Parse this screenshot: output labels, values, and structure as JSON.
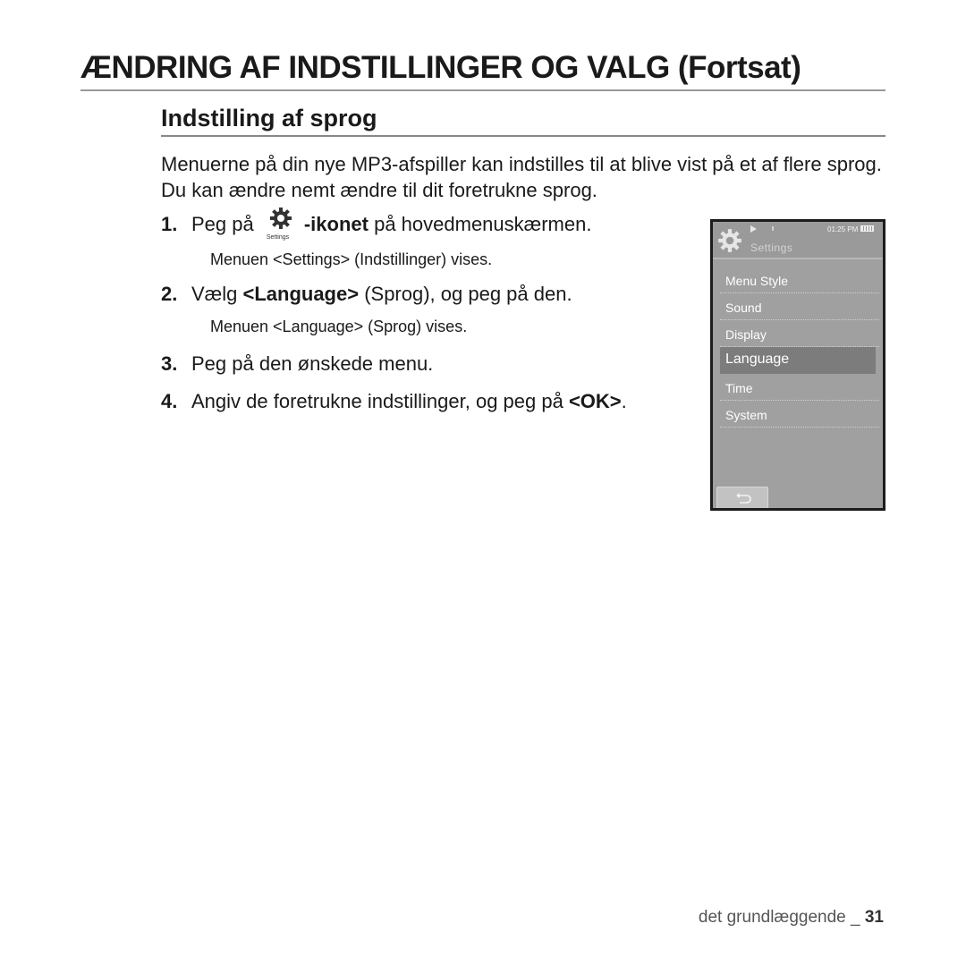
{
  "page": {
    "title": "ÆNDRING AF INDSTILLINGER OG VALG (Fortsat)",
    "section_title": "Indstilling af sprog",
    "intro": "Menuerne på din nye MP3-afspiller kan indstilles til at blive vist på et af flere sprog. Du kan ændre nemt ændre til dit foretrukne sprog.",
    "steps": [
      {
        "num": "1.",
        "pre": "Peg på",
        "icon": "settings-gear-icon",
        "icon_label": "Settings",
        "bold": "-ikonet",
        "post": " på hovedmenuskærmen.",
        "sub": "Menuen <Settings> (Indstillinger) vises."
      },
      {
        "num": "2.",
        "pre": "Vælg ",
        "bold": "<Language>",
        "post": " (Sprog), og peg på den.",
        "sub": "Menuen <Language> (Sprog) vises."
      },
      {
        "num": "3.",
        "text": "Peg på den ønskede menu."
      },
      {
        "num": "4.",
        "pre": "Angiv de foretrukne indstillinger, og peg på ",
        "bold": "<OK>",
        "post": "."
      }
    ]
  },
  "device": {
    "time": "01:25 PM",
    "title": "Settings",
    "menu": [
      {
        "label": "Menu Style",
        "selected": false
      },
      {
        "label": "Sound",
        "selected": false
      },
      {
        "label": "Display",
        "selected": false
      },
      {
        "label": "Language",
        "selected": true
      },
      {
        "label": "Time",
        "selected": false
      },
      {
        "label": "System",
        "selected": false
      }
    ],
    "back_icon": "back-arrow-icon"
  },
  "footer": {
    "section": "det grundlæggende _ ",
    "page_number": "31"
  }
}
